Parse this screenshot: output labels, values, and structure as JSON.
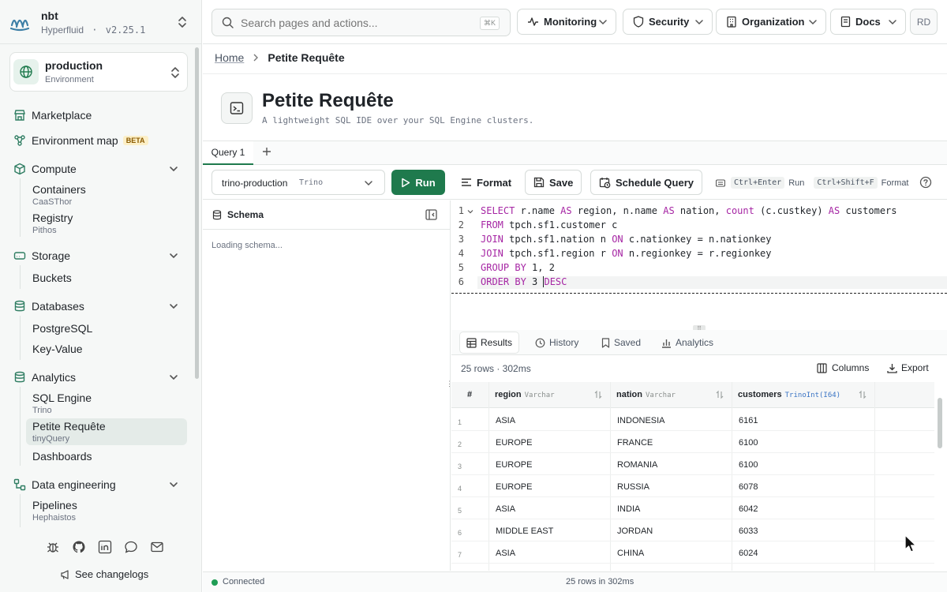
{
  "brand": {
    "name": "nbt",
    "company": "Hyperfluid",
    "separator": "·",
    "version": "v2.25.1"
  },
  "environment": {
    "name": "production",
    "type": "Environment"
  },
  "nav": {
    "marketplace": "Marketplace",
    "env_map": "Environment map",
    "env_map_badge": "BETA",
    "compute": {
      "label": "Compute",
      "items": [
        {
          "label": "Containers",
          "sub": "CaaSThor"
        },
        {
          "label": "Registry",
          "sub": "Pithos"
        }
      ]
    },
    "storage": {
      "label": "Storage",
      "items": [
        {
          "label": "Buckets"
        }
      ]
    },
    "databases": {
      "label": "Databases",
      "items": [
        {
          "label": "PostgreSQL"
        },
        {
          "label": "Key-Value"
        }
      ]
    },
    "analytics": {
      "label": "Analytics",
      "items": [
        {
          "label": "SQL Engine",
          "sub": "Trino"
        },
        {
          "label": "Petite Requête",
          "sub": "tinyQuery"
        },
        {
          "label": "Dashboards"
        }
      ]
    },
    "data_engineering": {
      "label": "Data engineering",
      "items": [
        {
          "label": "Pipelines",
          "sub": "Hephaistos"
        }
      ]
    }
  },
  "changelog": "See changelogs",
  "search": {
    "placeholder": "Search pages and actions...",
    "shortcut": "⌘K"
  },
  "topnav": {
    "monitoring": "Monitoring",
    "security": "Security",
    "organization": "Organization",
    "docs": "Docs",
    "avatar": "RD"
  },
  "breadcrumb": {
    "home": "Home",
    "current": "Petite Requête"
  },
  "page": {
    "title": "Petite Requête",
    "subtitle": "A lightweight SQL IDE over your SQL Engine clusters."
  },
  "tabs": [
    {
      "label": "Query 1"
    }
  ],
  "toolbar": {
    "cluster": "trino-production",
    "engine": "Trino",
    "run": "Run",
    "format": "Format",
    "save": "Save",
    "schedule": "Schedule Query",
    "kbd_run": "Ctrl+Enter",
    "kbd_run_label": "Run",
    "kbd_format": "Ctrl+Shift+F",
    "kbd_format_label": "Format"
  },
  "schema": {
    "title": "Schema",
    "loading": "Loading schema..."
  },
  "editor": {
    "lines": [
      {
        "n": "1",
        "parts": [
          [
            "kw",
            "SELECT"
          ],
          [
            "",
            "r.name "
          ],
          [
            "kw",
            "AS"
          ],
          [
            "",
            "region, n.name "
          ],
          [
            "kw",
            "AS"
          ],
          [
            "",
            "nation, "
          ],
          [
            "kw",
            "count"
          ],
          [
            "",
            "(c.custkey) "
          ],
          [
            "kw",
            "AS"
          ],
          [
            "",
            "customers"
          ]
        ]
      },
      {
        "n": "2",
        "parts": [
          [
            "kw",
            "FROM"
          ],
          [
            "",
            "tpch.sf1.customer c"
          ]
        ]
      },
      {
        "n": "3",
        "parts": [
          [
            "kw",
            "JOIN"
          ],
          [
            "",
            "tpch.sf1.nation n "
          ],
          [
            "kw",
            "ON"
          ],
          [
            "",
            "c.nationkey = n.nationkey"
          ]
        ]
      },
      {
        "n": "4",
        "parts": [
          [
            "kw",
            "JOIN"
          ],
          [
            "",
            "tpch.sf1.region r "
          ],
          [
            "kw",
            "ON"
          ],
          [
            "",
            "n.regionkey = r.regionkey"
          ]
        ]
      },
      {
        "n": "5",
        "parts": [
          [
            "kw",
            "GROUP BY"
          ],
          [
            "",
            "1, 2"
          ]
        ]
      },
      {
        "n": "6",
        "parts": [
          [
            "kw",
            "ORDER BY"
          ],
          [
            "",
            "3 "
          ],
          [
            "kw",
            "DESC"
          ]
        ]
      }
    ]
  },
  "results": {
    "tabs": {
      "results": "Results",
      "history": "History",
      "saved": "Saved",
      "analytics": "Analytics"
    },
    "summary": "25 rows · 302ms",
    "columns_btn": "Columns",
    "export_btn": "Export",
    "headers": {
      "num": "#",
      "region": "region",
      "region_type": "Varchar",
      "nation": "nation",
      "nation_type": "Varchar",
      "customers": "customers",
      "customers_type": "TrinoInt(I64)"
    },
    "rows": [
      {
        "n": "1",
        "region": "ASIA",
        "nation": "INDONESIA",
        "customers": "6161"
      },
      {
        "n": "2",
        "region": "EUROPE",
        "nation": "FRANCE",
        "customers": "6100"
      },
      {
        "n": "3",
        "region": "EUROPE",
        "nation": "ROMANIA",
        "customers": "6100"
      },
      {
        "n": "4",
        "region": "EUROPE",
        "nation": "RUSSIA",
        "customers": "6078"
      },
      {
        "n": "5",
        "region": "ASIA",
        "nation": "INDIA",
        "customers": "6042"
      },
      {
        "n": "6",
        "region": "MIDDLE EAST",
        "nation": "JORDAN",
        "customers": "6033"
      },
      {
        "n": "7",
        "region": "ASIA",
        "nation": "CHINA",
        "customers": "6024"
      }
    ]
  },
  "status": {
    "connection": "Connected",
    "rows": "25 rows in 302ms"
  },
  "colors": {
    "accent": "#1f7a4d",
    "keyword": "#a626a4",
    "connected": "#1f9d55"
  }
}
